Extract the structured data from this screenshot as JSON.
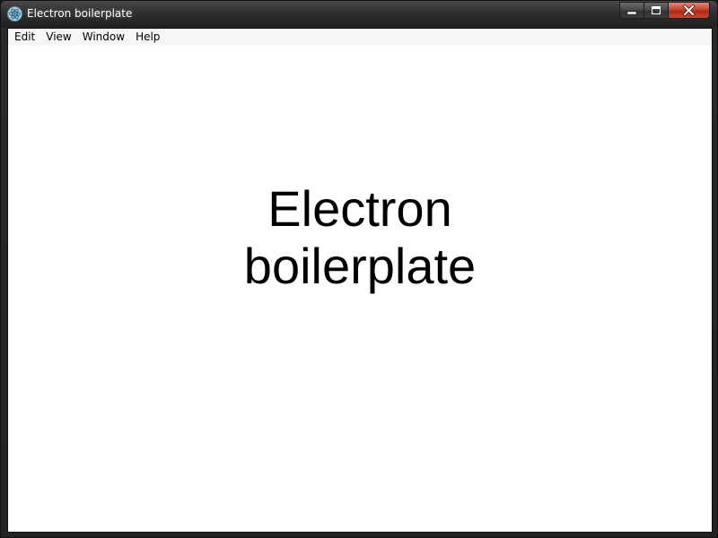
{
  "window": {
    "title": "Electron boilerplate",
    "icon": "electron-app-icon",
    "controls": [
      "minimize-icon",
      "maximize-icon",
      "close-icon"
    ]
  },
  "menubar": {
    "items": [
      {
        "label": "Edit"
      },
      {
        "label": "View"
      },
      {
        "label": "Window"
      },
      {
        "label": "Help"
      }
    ]
  },
  "content": {
    "heading_line1": "Electron",
    "heading_line2": "boilerplate"
  },
  "colors": {
    "titlebar": "#2f2f2f",
    "close_button": "#c7432e",
    "menubar_bg": "#f5f6f7",
    "content_bg": "#ffffff",
    "text": "#000000"
  }
}
